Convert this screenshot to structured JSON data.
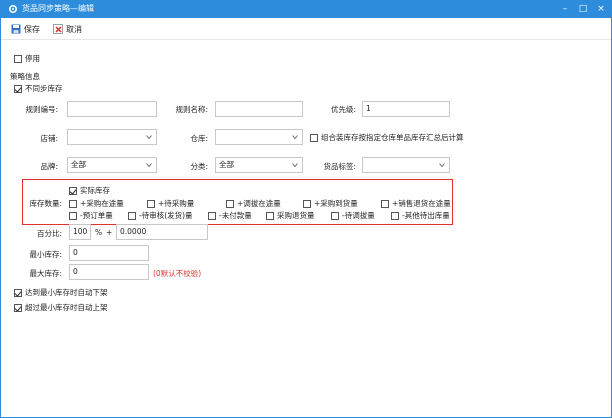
{
  "window": {
    "title": "货品同步策略—编辑",
    "minimize": "–",
    "maximize": "□",
    "close": "×"
  },
  "toolbar": {
    "save_label": "保存",
    "cancel_label": "取消"
  },
  "disable_label": "停用",
  "section_title": "策略信息",
  "no_sync_stock_label": "不同步库存",
  "fields": {
    "rule_no_label": "规则编号:",
    "rule_no_value": "",
    "rule_name_label": "规则名称:",
    "rule_name_value": "",
    "priority_label": "优先级:",
    "priority_value": "1",
    "shop_label": "店铺:",
    "shop_value": "",
    "warehouse_label": "仓库:",
    "warehouse_value": "",
    "combo_label": "组合装库存按指定仓库单品库存汇总后计算",
    "brand_label": "品牌:",
    "brand_value": "全部",
    "category_label": "分类:",
    "category_value": "全部",
    "goods_tag_label": "货品标签:",
    "goods_tag_value": ""
  },
  "stock": {
    "label": "库存数量:",
    "actual": "实际库存",
    "row1": [
      "+采购在途量",
      "+待采购量",
      "+调拔在途量",
      "+采购到货量",
      "+销售退货在途量"
    ],
    "row2": [
      "-预订单量",
      "-待审核(发货)量",
      "-未付款量",
      "采购退货量",
      "-待调拔量",
      "-其他待出库量"
    ]
  },
  "percent": {
    "label": "百分比:",
    "value": "100",
    "unit": "%",
    "plus": "+",
    "add_value": "0.0000"
  },
  "min_stock": {
    "label": "最小库存:",
    "value": "0"
  },
  "max_stock": {
    "label": "最大库存:",
    "value": "0",
    "hint": "(0默认不校验)"
  },
  "auto_down_label": "达到最小库存时自动下架",
  "auto_up_label": "超过最小库存时自动上架",
  "colors": {
    "titlebar": "#2d8cdb",
    "highlight": "#e03030"
  }
}
